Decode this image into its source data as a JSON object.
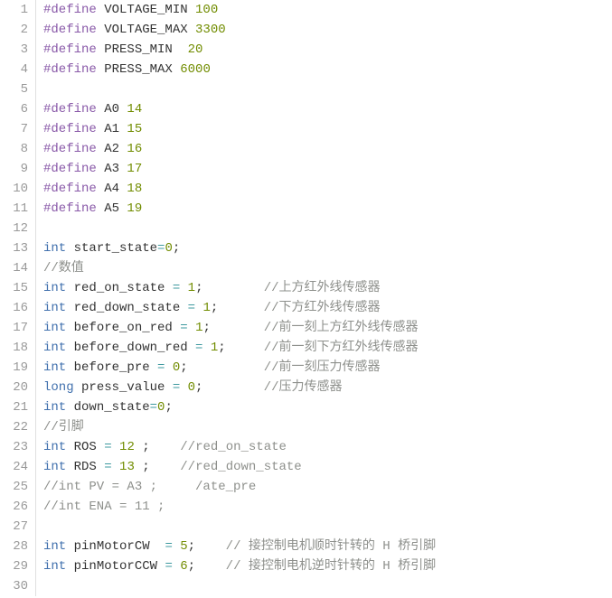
{
  "lines": [
    {
      "num": "1",
      "tokens": [
        {
          "cls": "preprocessor",
          "text": "#define"
        },
        {
          "cls": "text",
          "text": " VOLTAGE_MIN "
        },
        {
          "cls": "number",
          "text": "100"
        }
      ]
    },
    {
      "num": "2",
      "tokens": [
        {
          "cls": "preprocessor",
          "text": "#define"
        },
        {
          "cls": "text",
          "text": " VOLTAGE_MAX "
        },
        {
          "cls": "number",
          "text": "3300"
        }
      ]
    },
    {
      "num": "3",
      "tokens": [
        {
          "cls": "preprocessor",
          "text": "#define"
        },
        {
          "cls": "text",
          "text": " PRESS_MIN  "
        },
        {
          "cls": "number",
          "text": "20"
        }
      ]
    },
    {
      "num": "4",
      "tokens": [
        {
          "cls": "preprocessor",
          "text": "#define"
        },
        {
          "cls": "text",
          "text": " PRESS_MAX "
        },
        {
          "cls": "number",
          "text": "6000"
        }
      ]
    },
    {
      "num": "5",
      "tokens": []
    },
    {
      "num": "6",
      "tokens": [
        {
          "cls": "preprocessor",
          "text": "#define"
        },
        {
          "cls": "text",
          "text": " A0 "
        },
        {
          "cls": "number",
          "text": "14"
        }
      ]
    },
    {
      "num": "7",
      "tokens": [
        {
          "cls": "preprocessor",
          "text": "#define"
        },
        {
          "cls": "text",
          "text": " A1 "
        },
        {
          "cls": "number",
          "text": "15"
        }
      ]
    },
    {
      "num": "8",
      "tokens": [
        {
          "cls": "preprocessor",
          "text": "#define"
        },
        {
          "cls": "text",
          "text": " A2 "
        },
        {
          "cls": "number",
          "text": "16"
        }
      ]
    },
    {
      "num": "9",
      "tokens": [
        {
          "cls": "preprocessor",
          "text": "#define"
        },
        {
          "cls": "text",
          "text": " A3 "
        },
        {
          "cls": "number",
          "text": "17"
        }
      ]
    },
    {
      "num": "10",
      "tokens": [
        {
          "cls": "preprocessor",
          "text": "#define"
        },
        {
          "cls": "text",
          "text": " A4 "
        },
        {
          "cls": "number",
          "text": "18"
        }
      ]
    },
    {
      "num": "11",
      "tokens": [
        {
          "cls": "preprocessor",
          "text": "#define"
        },
        {
          "cls": "text",
          "text": " A5 "
        },
        {
          "cls": "number",
          "text": "19"
        }
      ]
    },
    {
      "num": "12",
      "tokens": []
    },
    {
      "num": "13",
      "tokens": [
        {
          "cls": "type",
          "text": "int"
        },
        {
          "cls": "text",
          "text": " start_state"
        },
        {
          "cls": "operator",
          "text": "="
        },
        {
          "cls": "number",
          "text": "0"
        },
        {
          "cls": "text",
          "text": ";"
        }
      ]
    },
    {
      "num": "14",
      "tokens": [
        {
          "cls": "comment",
          "text": "//数值"
        }
      ]
    },
    {
      "num": "15",
      "tokens": [
        {
          "cls": "type",
          "text": "int"
        },
        {
          "cls": "text",
          "text": " red_on_state "
        },
        {
          "cls": "operator",
          "text": "="
        },
        {
          "cls": "text",
          "text": " "
        },
        {
          "cls": "number",
          "text": "1"
        },
        {
          "cls": "text",
          "text": ";        "
        },
        {
          "cls": "comment",
          "text": "//上方红外线传感器"
        }
      ]
    },
    {
      "num": "16",
      "tokens": [
        {
          "cls": "type",
          "text": "int"
        },
        {
          "cls": "text",
          "text": " red_down_state "
        },
        {
          "cls": "operator",
          "text": "="
        },
        {
          "cls": "text",
          "text": " "
        },
        {
          "cls": "number",
          "text": "1"
        },
        {
          "cls": "text",
          "text": ";      "
        },
        {
          "cls": "comment",
          "text": "//下方红外线传感器"
        }
      ]
    },
    {
      "num": "17",
      "tokens": [
        {
          "cls": "type",
          "text": "int"
        },
        {
          "cls": "text",
          "text": " before_on_red "
        },
        {
          "cls": "operator",
          "text": "="
        },
        {
          "cls": "text",
          "text": " "
        },
        {
          "cls": "number",
          "text": "1"
        },
        {
          "cls": "text",
          "text": ";       "
        },
        {
          "cls": "comment",
          "text": "//前一刻上方红外线传感器"
        }
      ]
    },
    {
      "num": "18",
      "tokens": [
        {
          "cls": "type",
          "text": "int"
        },
        {
          "cls": "text",
          "text": " before_down_red "
        },
        {
          "cls": "operator",
          "text": "="
        },
        {
          "cls": "text",
          "text": " "
        },
        {
          "cls": "number",
          "text": "1"
        },
        {
          "cls": "text",
          "text": ";     "
        },
        {
          "cls": "comment",
          "text": "//前一刻下方红外线传感器"
        }
      ]
    },
    {
      "num": "19",
      "tokens": [
        {
          "cls": "type",
          "text": "int"
        },
        {
          "cls": "text",
          "text": " before_pre "
        },
        {
          "cls": "operator",
          "text": "="
        },
        {
          "cls": "text",
          "text": " "
        },
        {
          "cls": "number",
          "text": "0"
        },
        {
          "cls": "text",
          "text": ";          "
        },
        {
          "cls": "comment",
          "text": "//前一刻压力传感器"
        }
      ]
    },
    {
      "num": "20",
      "tokens": [
        {
          "cls": "type",
          "text": "long"
        },
        {
          "cls": "text",
          "text": " press_value "
        },
        {
          "cls": "operator",
          "text": "="
        },
        {
          "cls": "text",
          "text": " "
        },
        {
          "cls": "number",
          "text": "0"
        },
        {
          "cls": "text",
          "text": ";        "
        },
        {
          "cls": "comment",
          "text": "//压力传感器"
        }
      ]
    },
    {
      "num": "21",
      "tokens": [
        {
          "cls": "type",
          "text": "int"
        },
        {
          "cls": "text",
          "text": " down_state"
        },
        {
          "cls": "operator",
          "text": "="
        },
        {
          "cls": "number",
          "text": "0"
        },
        {
          "cls": "text",
          "text": ";"
        }
      ]
    },
    {
      "num": "22",
      "tokens": [
        {
          "cls": "comment",
          "text": "//引脚"
        }
      ]
    },
    {
      "num": "23",
      "tokens": [
        {
          "cls": "type",
          "text": "int"
        },
        {
          "cls": "text",
          "text": " ROS "
        },
        {
          "cls": "operator",
          "text": "="
        },
        {
          "cls": "text",
          "text": " "
        },
        {
          "cls": "number",
          "text": "12"
        },
        {
          "cls": "text",
          "text": " ;    "
        },
        {
          "cls": "comment",
          "text": "//red_on_state"
        }
      ]
    },
    {
      "num": "24",
      "tokens": [
        {
          "cls": "type",
          "text": "int"
        },
        {
          "cls": "text",
          "text": " RDS "
        },
        {
          "cls": "operator",
          "text": "="
        },
        {
          "cls": "text",
          "text": " "
        },
        {
          "cls": "number",
          "text": "13"
        },
        {
          "cls": "text",
          "text": " ;    "
        },
        {
          "cls": "comment",
          "text": "//red_down_state"
        }
      ]
    },
    {
      "num": "25",
      "tokens": [
        {
          "cls": "comment",
          "text": "//int PV = A3 ;     /ate_pre"
        }
      ]
    },
    {
      "num": "26",
      "tokens": [
        {
          "cls": "comment",
          "text": "//int ENA = 11 ;"
        }
      ]
    },
    {
      "num": "27",
      "tokens": []
    },
    {
      "num": "28",
      "tokens": [
        {
          "cls": "type",
          "text": "int"
        },
        {
          "cls": "text",
          "text": " pinMotorCW  "
        },
        {
          "cls": "operator",
          "text": "="
        },
        {
          "cls": "text",
          "text": " "
        },
        {
          "cls": "number",
          "text": "5"
        },
        {
          "cls": "text",
          "text": ";    "
        },
        {
          "cls": "comment",
          "text": "// 接控制电机顺时针转的 H 桥引脚"
        }
      ]
    },
    {
      "num": "29",
      "tokens": [
        {
          "cls": "type",
          "text": "int"
        },
        {
          "cls": "text",
          "text": " pinMotorCCW "
        },
        {
          "cls": "operator",
          "text": "="
        },
        {
          "cls": "text",
          "text": " "
        },
        {
          "cls": "number",
          "text": "6"
        },
        {
          "cls": "text",
          "text": ";    "
        },
        {
          "cls": "comment",
          "text": "// 接控制电机逆时针转的 H 桥引脚"
        }
      ]
    },
    {
      "num": "30",
      "tokens": []
    }
  ]
}
